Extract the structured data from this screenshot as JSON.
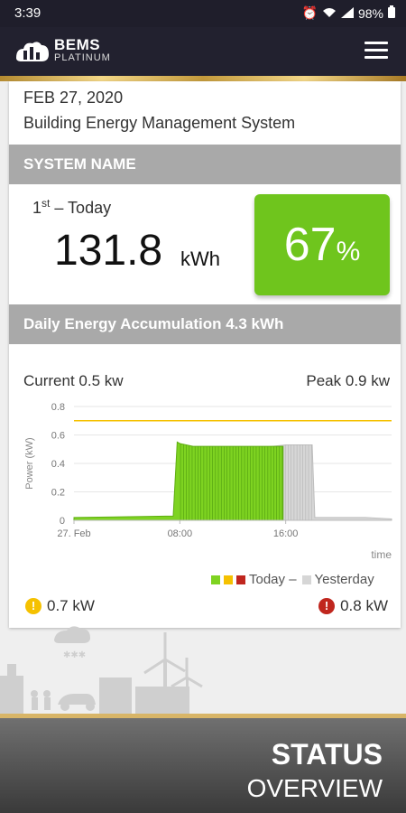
{
  "statusbar": {
    "time": "3:39",
    "battery": "98%"
  },
  "app": {
    "brand": "BEMS",
    "brand_sub": "PLATINUM"
  },
  "card": {
    "date": "FEB 27, 2020",
    "subtitle": "Building Energy Management System",
    "system_header": "SYSTEM NAME",
    "rank_sup": "st",
    "rank_num": "1",
    "rank_label": "– Today",
    "energy_value": "131.8",
    "energy_unit": "kWh",
    "percent_value": "67",
    "percent_symbol": "%",
    "daily_header": "Daily Energy Accumulation 4.3 kWh",
    "current": "Current 0.5 kw",
    "peak": "Peak 0.9 kw",
    "legend_today": "Today –",
    "legend_yesterday": "Yesterday",
    "warn_value": "0.7 kW",
    "alert_value": "0.8 kW"
  },
  "colors": {
    "today": "#7ed321",
    "warn": "#f5c100",
    "alert": "#c0261e",
    "yesterday": "#d6d6d6"
  },
  "chart_data": {
    "type": "area",
    "ylabel": "Power (kW)",
    "xlabel": "time",
    "ylim": [
      0,
      0.8
    ],
    "yticks": [
      "0",
      "0.2",
      "0.4",
      "0.6",
      "0.8"
    ],
    "xticks": [
      {
        "label": "27. Feb",
        "hour": 0
      },
      {
        "label": "08:00",
        "hour": 8
      },
      {
        "label": "16:00",
        "hour": 16
      }
    ],
    "xrange": [
      0,
      24
    ],
    "threshold": 0.7,
    "series": [
      {
        "name": "Today",
        "x": [
          0,
          7.5,
          7.8,
          8.0,
          9,
          10,
          11,
          12,
          13,
          14,
          15,
          15.8
        ],
        "y": [
          0.02,
          0.03,
          0.55,
          0.54,
          0.52,
          0.52,
          0.52,
          0.52,
          0.52,
          0.52,
          0.52,
          0.52
        ]
      },
      {
        "name": "Yesterday",
        "x": [
          0,
          7.5,
          7.8,
          8.0,
          9,
          10,
          11,
          12,
          13,
          14,
          15,
          16,
          17,
          18,
          18.2,
          20,
          22,
          24
        ],
        "y": [
          0.01,
          0.02,
          0.52,
          0.51,
          0.51,
          0.51,
          0.51,
          0.51,
          0.51,
          0.51,
          0.52,
          0.53,
          0.53,
          0.53,
          0.02,
          0.02,
          0.02,
          0.01
        ]
      }
    ]
  },
  "footer": {
    "title": "STATUS",
    "subtitle": "OVERVIEW"
  }
}
